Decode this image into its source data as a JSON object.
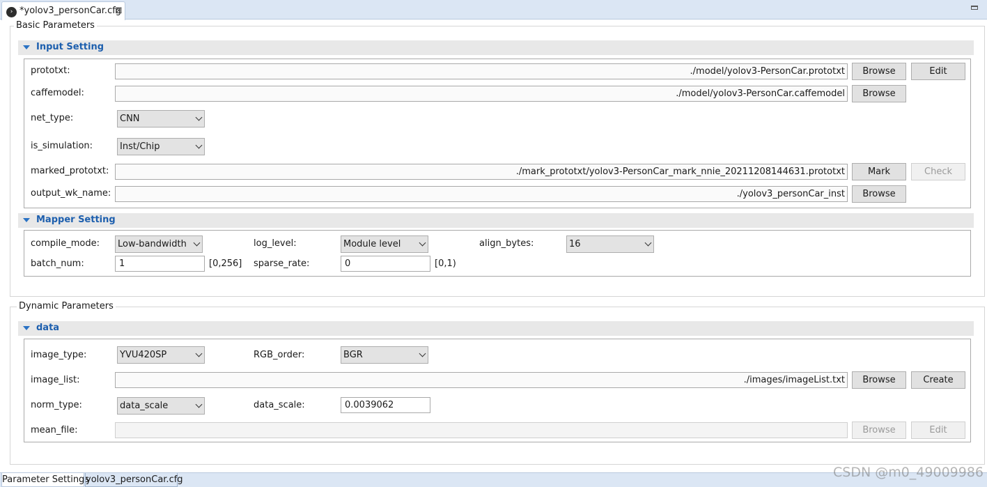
{
  "editor": {
    "tab_title": "*yolov3_personCar.cfg",
    "tab_close_glyph": "⊠",
    "file_icon": "run-icon",
    "file_icon_glyph": "›"
  },
  "basic": {
    "group_title": "Basic Parameters",
    "input_setting": {
      "title": "Input Setting",
      "prototxt": {
        "label": "prototxt:",
        "value": "./model/yolov3-PersonCar.prototxt",
        "browse": "Browse",
        "edit": "Edit"
      },
      "caffemodel": {
        "label": "caffemodel:",
        "value": "./model/yolov3-PersonCar.caffemodel",
        "browse": "Browse"
      },
      "net_type": {
        "label": "net_type:",
        "value": "CNN"
      },
      "is_simulation": {
        "label": "is_simulation:",
        "value": "Inst/Chip"
      },
      "marked_prototxt": {
        "label": "marked_prototxt:",
        "value": "./mark_prototxt/yolov3-PersonCar_mark_nnie_20211208144631.prototxt",
        "mark": "Mark",
        "check": "Check"
      },
      "output_wk_name": {
        "label": "output_wk_name:",
        "value": "./yolov3_personCar_inst",
        "browse": "Browse"
      }
    },
    "mapper_setting": {
      "title": "Mapper Setting",
      "compile_mode": {
        "label": "compile_mode:",
        "value": "Low-bandwidth"
      },
      "log_level": {
        "label": "log_level:",
        "value": "Module level"
      },
      "align_bytes": {
        "label": "align_bytes:",
        "value": "16"
      },
      "batch_num": {
        "label": "batch_num:",
        "value": "1",
        "range": "[0,256]"
      },
      "sparse_rate": {
        "label": "sparse_rate:",
        "value": "0",
        "range": "[0,1)"
      }
    }
  },
  "dynamic": {
    "group_title": "Dynamic Parameters",
    "data": {
      "title": "data",
      "image_type": {
        "label": "image_type:",
        "value": "YVU420SP"
      },
      "rgb_order": {
        "label": "RGB_order:",
        "value": "BGR"
      },
      "image_list": {
        "label": "image_list:",
        "value": "./images/imageList.txt",
        "browse": "Browse",
        "create": "Create"
      },
      "norm_type": {
        "label": "norm_type:",
        "value": "data_scale"
      },
      "data_scale": {
        "label": "data_scale:",
        "value": "0.0039062"
      },
      "mean_file": {
        "label": "mean_file:",
        "value": "",
        "browse": "Browse",
        "edit": "Edit"
      }
    }
  },
  "bottom_tabs": [
    "Parameter Settings",
    "yolov3_personCar.cfg"
  ],
  "watermark": "CSDN @m0_49009986"
}
